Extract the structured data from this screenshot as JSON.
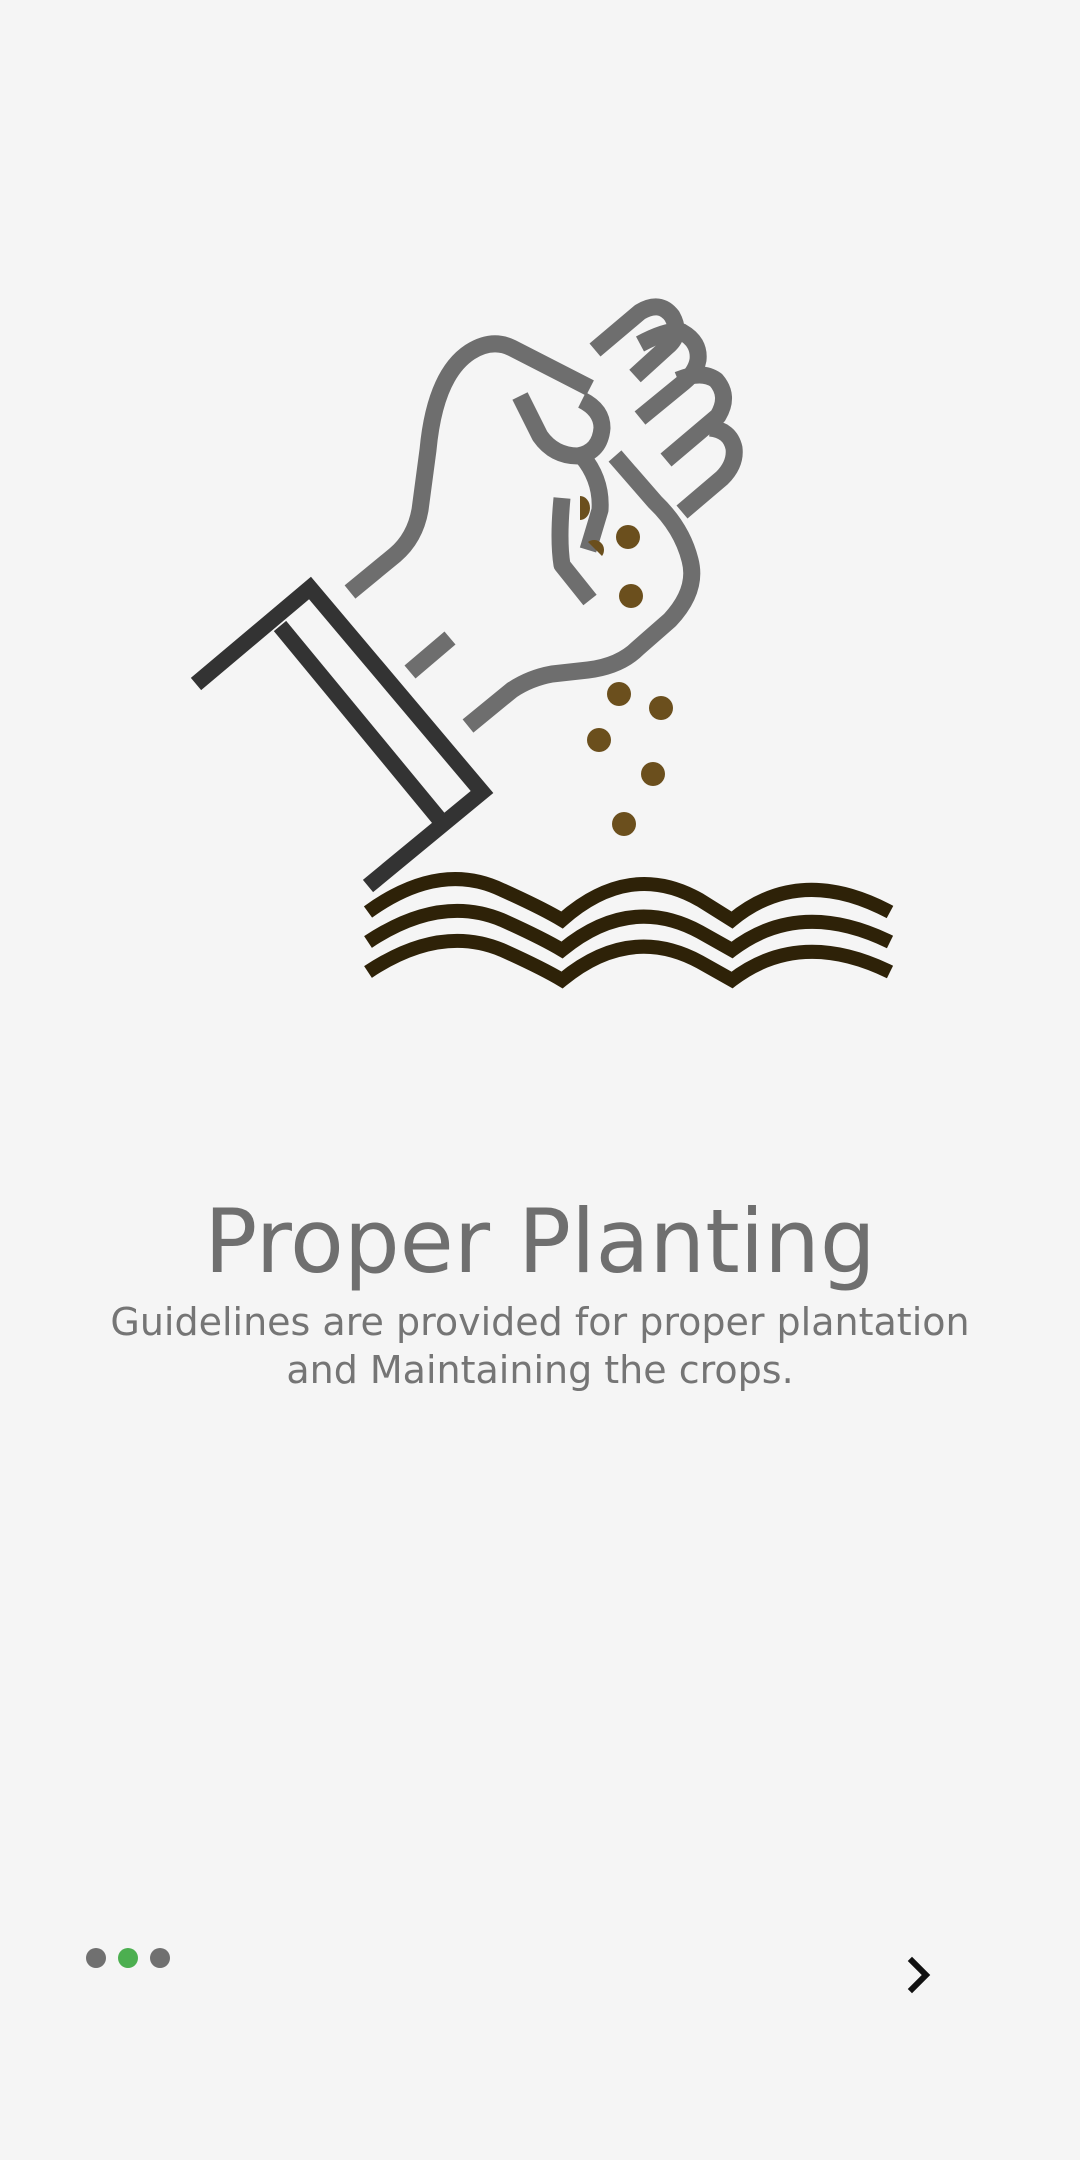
{
  "onboarding": {
    "title": "Proper Planting",
    "subtitle": "Guidelines are provided for proper plantation and Maintaining the crops.",
    "illustration_icon": "hand-sowing-seeds-icon",
    "next_icon": "chevron-right-icon"
  },
  "pager": {
    "total_pages": 3,
    "current_page": 2
  },
  "colors": {
    "background": "#f5f5f5",
    "accent": "#4caf50",
    "inactive_dot": "#707070",
    "text": "#6f6f6f",
    "seed": "#6b4f1d",
    "soil": "#2e2208",
    "sleeve": "#333333",
    "hand": "#6e6e6e"
  }
}
